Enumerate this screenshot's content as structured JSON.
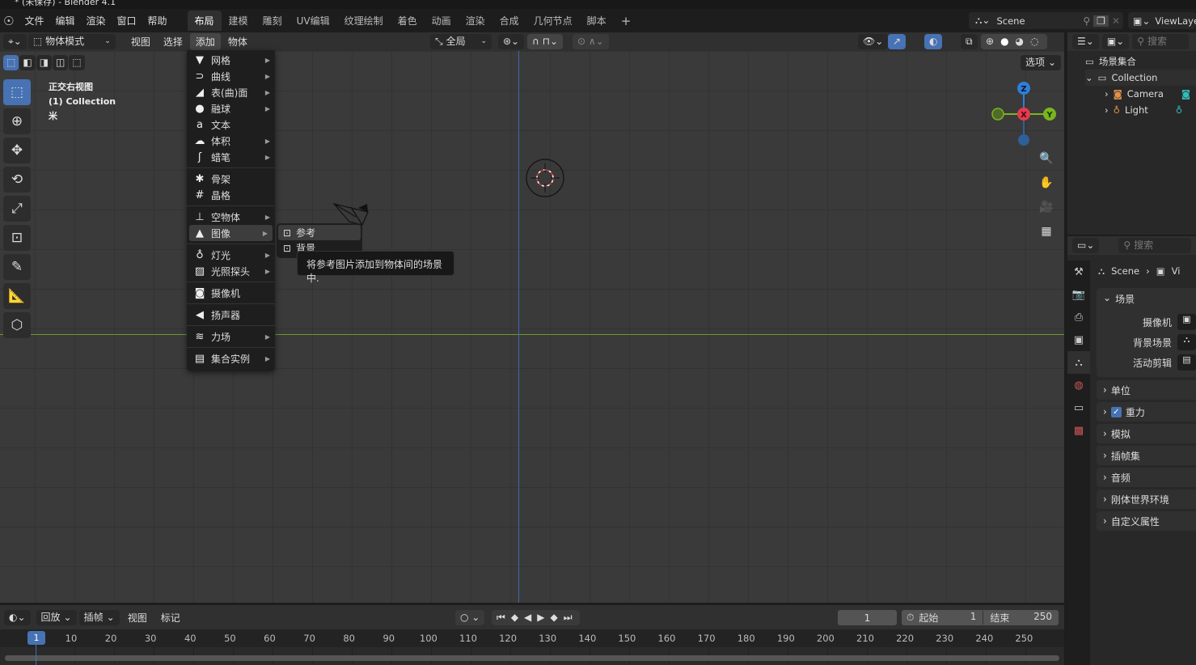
{
  "window": {
    "title": "* (未保存) - Blender 4.1"
  },
  "top_menu": [
    "文件",
    "编辑",
    "渲染",
    "窗口",
    "帮助"
  ],
  "workspaces": [
    "布局",
    "建模",
    "雕刻",
    "UV编辑",
    "纹理绘制",
    "着色",
    "动画",
    "渲染",
    "合成",
    "几何节点",
    "脚本"
  ],
  "workspace_add": "+",
  "scene": {
    "name": "Scene",
    "view_layer": "ViewLayer"
  },
  "viewport_header": {
    "mode": "物体模式",
    "menus": [
      "视图",
      "选择",
      "添加",
      "物体"
    ],
    "transform_orientation": "全局",
    "options": "选项"
  },
  "viewport_info": {
    "view": "正交右视图",
    "collection": "(1) Collection",
    "units": "米"
  },
  "add_menu": {
    "items": [
      {
        "icon": "mesh-icon",
        "glyph": "▼",
        "label": "网格",
        "sub": true
      },
      {
        "icon": "curve-icon",
        "glyph": "⊃",
        "label": "曲线",
        "sub": true
      },
      {
        "icon": "surface-icon",
        "glyph": "◢",
        "label": "表(曲)面",
        "sub": true
      },
      {
        "icon": "metaball-icon",
        "glyph": "●",
        "label": "融球",
        "sub": true
      },
      {
        "icon": "text-icon",
        "glyph": "a",
        "label": "文本",
        "sub": false
      },
      {
        "icon": "volume-icon",
        "glyph": "☁",
        "label": "体积",
        "sub": true
      },
      {
        "icon": "grease-pencil-icon",
        "glyph": "ʃ",
        "label": "蜡笔",
        "sub": true
      },
      {
        "sep": true
      },
      {
        "icon": "armature-icon",
        "glyph": "✱",
        "label": "骨架",
        "sub": false
      },
      {
        "icon": "lattice-icon",
        "glyph": "#",
        "label": "晶格",
        "sub": false
      },
      {
        "sep": true
      },
      {
        "icon": "empty-icon",
        "glyph": "⊥",
        "label": "空物体",
        "sub": true
      },
      {
        "icon": "image-icon",
        "glyph": "▲",
        "label": "图像",
        "sub": true,
        "highlight": true
      },
      {
        "sep": true
      },
      {
        "icon": "light-icon",
        "glyph": "♁",
        "label": "灯光",
        "sub": true
      },
      {
        "icon": "light-probe-icon",
        "glyph": "▨",
        "label": "光照探头",
        "sub": true
      },
      {
        "sep": true
      },
      {
        "icon": "camera-icon",
        "glyph": "◙",
        "label": "摄像机",
        "sub": false
      },
      {
        "sep": true
      },
      {
        "icon": "speaker-icon",
        "glyph": "◀",
        "label": "扬声器",
        "sub": false
      },
      {
        "sep": true
      },
      {
        "icon": "force-field-icon",
        "glyph": "≋",
        "label": "力场",
        "sub": true
      },
      {
        "sep": true
      },
      {
        "icon": "collection-instance-icon",
        "glyph": "▤",
        "label": "集合实例",
        "sub": true
      }
    ]
  },
  "image_submenu": {
    "items": [
      "参考",
      "背景"
    ]
  },
  "tooltip": "将参考图片添加到物体间的场景中.",
  "gizmo": {
    "z": "Z",
    "x": "X",
    "y": "Y"
  },
  "outliner": {
    "search_placeholder": "搜索",
    "root": "场景集合",
    "collection": "Collection",
    "objects": [
      "Camera",
      "Light"
    ]
  },
  "properties": {
    "search_placeholder": "搜索",
    "breadcrumb": [
      "Scene",
      "View Layer"
    ],
    "scene_panel": "场景",
    "rows": [
      "摄像机",
      "背景场景",
      "活动剪辑"
    ],
    "panels": [
      "单位",
      "重力",
      "模拟",
      "插帧集",
      "音频",
      "刚体世界环境",
      "自定义属性"
    ],
    "gravity_checked": true
  },
  "timeline": {
    "menus": [
      "回放",
      "插帧",
      "视图",
      "标记"
    ],
    "current_frame": "1",
    "start_label": "起始",
    "start": "1",
    "end_label": "结束",
    "end": "250",
    "ticks": [
      "10",
      "20",
      "30",
      "40",
      "50",
      "60",
      "70",
      "80",
      "90",
      "100",
      "110",
      "120",
      "130",
      "140",
      "150",
      "160",
      "170",
      "180",
      "190",
      "200",
      "210",
      "220",
      "230",
      "240",
      "250"
    ]
  },
  "colors": {
    "accent": "#4772b3",
    "x_axis": "#e8394f",
    "y_axis": "#7ab51d",
    "z_axis": "#2f7fd8"
  }
}
